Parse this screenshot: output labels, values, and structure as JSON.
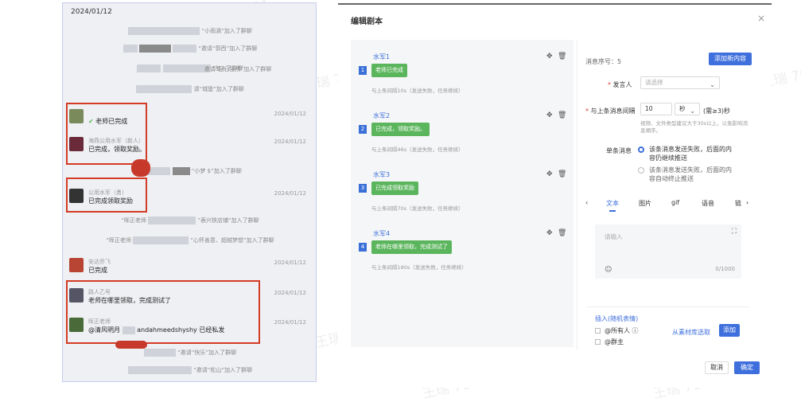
{
  "chat": {
    "date": "2024/01/12",
    "sys_lines": [
      "“小雨滴”加入了群聊",
      "“邀请“郭西”加入了群聊",
      "“加入了群聊",
      "邀请“回日自然”加入了群聊",
      "请“城堡”加入了群聊",
      "“小梦 $”加入了群聊",
      "“晖正老师",
      "”表兴铁店铺”加入了群聊",
      "“晖正老师",
      "”心怀善意、超越梦想”加入了群聊",
      "“邀请“快乐”加入了群聊",
      "“邀请“松山”加入了群聊"
    ],
    "messages": [
      {
        "sender": "",
        "text": "老师已完成",
        "time": "2024/01/12"
      },
      {
        "sender": "海燕公用水军（新人）",
        "text": "已完成，领取奖励。",
        "time": "2024/01/12"
      },
      {
        "sender": "公用水军（勇）",
        "text": "已完成领取奖励",
        "time": "2024/01/12"
      },
      {
        "sender": "安达乔飞",
        "text": "已完成",
        "time": "2024/01/12"
      },
      {
        "sender": "路人乙号",
        "text": "老师在哪里领取，完成测试了",
        "time": "2024/01/12"
      },
      {
        "sender": "晖正老师",
        "text": "@清风明月",
        "text2": "andahmeedshyshy 已经私发",
        "time": "2024/01/12"
      }
    ]
  },
  "dialog": {
    "title": "编辑剧本",
    "close": "×",
    "items": [
      {
        "name": "水军1",
        "num": "1",
        "bubble": "老师已完成",
        "note": ""
      },
      {
        "name": "水军2",
        "num": "2",
        "bubble": "已完成，领取奖励。",
        "note": "与上条间隔46s（发送失败，任务继续）"
      },
      {
        "name": "水军3",
        "num": "3",
        "bubble": "已完成领取奖励",
        "note": "与上条间隔70s（发送失败，任务继续）"
      },
      {
        "name": "水军4",
        "num": "4",
        "bubble": "老师在哪里领取，完成测试了",
        "note": "与上条间隔180s（发送失败，任务继续）"
      }
    ],
    "first_note": "与上条间隔10s（发送失败，任务继续）",
    "editor": {
      "seq_label": "消息序号：5",
      "add_button": "添加新内容",
      "speaker_label": "发言人",
      "speaker_placeholder": "请选择",
      "interval_label": "与上条消息间隔",
      "interval_value": "10",
      "interval_unit": "秒",
      "interval_hint": "(需≥3)秒",
      "interval_tip": "视频、文件类型建议大于30s以上，以免影响消息顺序。",
      "single_label": "单条消息",
      "option1": "该条消息发送失败，后面的内容仍继续推送",
      "option2": "该条消息发送失败，后面的内容自动终止推送",
      "tabs": [
        "文本",
        "图片",
        "gif",
        "语音",
        "链"
      ],
      "input_placeholder": "请输入",
      "counter": "0/1000",
      "insert_label": "插入(随机表情)",
      "all_label": "@所有人",
      "group_label": "@群主",
      "from_library": "从素材库选取",
      "add_small": "添加",
      "cancel": "取消",
      "confirm": "确定"
    }
  },
  "watermark": "王瑞 7074",
  "colors": {
    "primary": "#3e6fdc",
    "bubble": "#5bb55d",
    "red": "#d43b26"
  }
}
